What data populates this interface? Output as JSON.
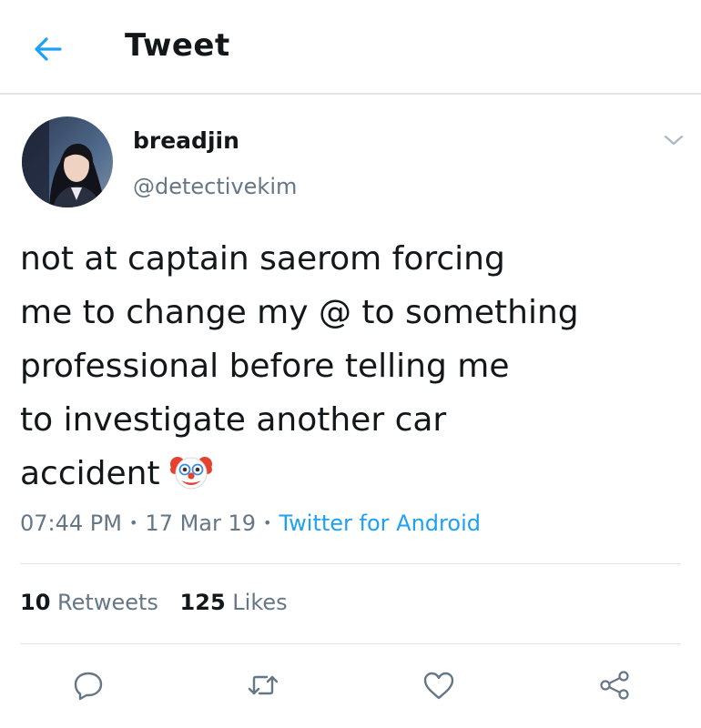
{
  "header": {
    "title": "Tweet",
    "back_icon": "arrow-left-icon"
  },
  "author": {
    "display_name": "breadjin",
    "handle": "@detectivekim"
  },
  "tweet": {
    "lines": [
      "not at captain saerom forcing",
      "me to change my @ to something",
      "professional before telling me",
      "to investigate another car",
      "accident"
    ],
    "emoji": "clown-face-emoji"
  },
  "meta": {
    "time": "07:44 PM",
    "date": "17 Mar 19",
    "source": "Twitter for Android",
    "separator": "•"
  },
  "stats": {
    "retweets_count": "10",
    "retweets_label": "Retweets",
    "likes_count": "125",
    "likes_label": "Likes"
  },
  "actions": [
    "reply-icon",
    "retweet-icon",
    "like-icon",
    "share-icon"
  ],
  "colors": {
    "accent": "#1da1f2",
    "text": "#14171a",
    "secondary": "#657786",
    "divider": "#e1e4e8"
  }
}
